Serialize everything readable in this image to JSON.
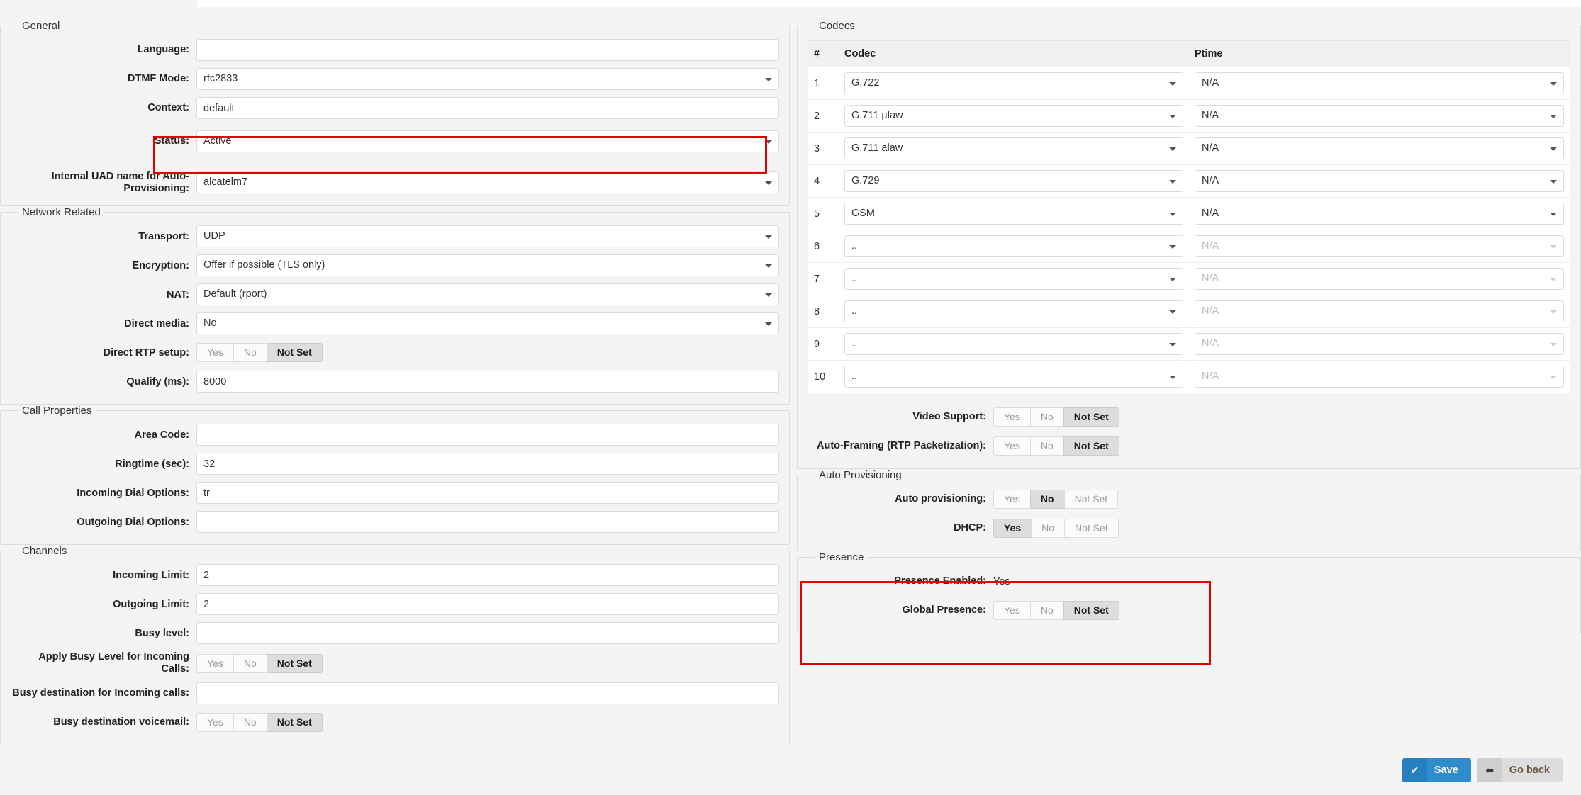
{
  "general": {
    "legend": "General",
    "fields": [
      {
        "label": "Language:",
        "type": "text",
        "value": ""
      },
      {
        "label": "DTMF Mode:",
        "type": "select",
        "value": "rfc2833"
      },
      {
        "label": "Context:",
        "type": "text",
        "value": "default"
      },
      {
        "label": "Status:",
        "type": "select",
        "value": "Active",
        "highlighted": true
      },
      {
        "label": "Internal UAD name for Auto-Provisioning:",
        "type": "select",
        "value": "alcatelm7"
      }
    ]
  },
  "network": {
    "legend": "Network Related",
    "fields": [
      {
        "label": "Transport:",
        "type": "select",
        "value": "UDP"
      },
      {
        "label": "Encryption:",
        "type": "select",
        "value": "Offer if possible (TLS only)"
      },
      {
        "label": "NAT:",
        "type": "select",
        "value": "Default (rport)"
      },
      {
        "label": "Direct media:",
        "type": "select",
        "value": "No"
      },
      {
        "label": "Direct RTP setup:",
        "type": "tristate",
        "value": "Not Set"
      },
      {
        "label": "Qualify (ms):",
        "type": "text",
        "value": "8000"
      }
    ]
  },
  "call_properties": {
    "legend": "Call Properties",
    "fields": [
      {
        "label": "Area Code:",
        "type": "text",
        "value": ""
      },
      {
        "label": "Ringtime (sec):",
        "type": "text",
        "value": "32"
      },
      {
        "label": "Incoming Dial Options:",
        "type": "text",
        "value": "tr"
      },
      {
        "label": "Outgoing Dial Options:",
        "type": "text",
        "value": ""
      }
    ]
  },
  "channels": {
    "legend": "Channels",
    "fields": [
      {
        "label": "Incoming Limit:",
        "type": "text",
        "value": "2"
      },
      {
        "label": "Outgoing Limit:",
        "type": "text",
        "value": "2"
      },
      {
        "label": "Busy level:",
        "type": "text",
        "value": ""
      },
      {
        "label": "Apply Busy Level for Incoming Calls:",
        "type": "tristate",
        "value": "Not Set"
      },
      {
        "label": "Busy destination for Incoming calls:",
        "type": "text",
        "value": ""
      },
      {
        "label": "Busy destination voicemail:",
        "type": "tristate",
        "value": "Not Set"
      }
    ]
  },
  "tristate_options": [
    "Yes",
    "No",
    "Not Set"
  ],
  "codecs": {
    "legend": "Codecs",
    "columns": [
      "#",
      "Codec",
      "Ptime"
    ],
    "rows": [
      {
        "index": "1",
        "codec": "G.722",
        "ptime": "N/A",
        "enabled": true
      },
      {
        "index": "2",
        "codec": "G.711 µlaw",
        "ptime": "N/A",
        "enabled": true
      },
      {
        "index": "3",
        "codec": "G.711 alaw",
        "ptime": "N/A",
        "enabled": true
      },
      {
        "index": "4",
        "codec": "G.729",
        "ptime": "N/A",
        "enabled": true
      },
      {
        "index": "5",
        "codec": "GSM",
        "ptime": "N/A",
        "enabled": true
      },
      {
        "index": "6",
        "codec": "..",
        "ptime": "N/A",
        "enabled": false
      },
      {
        "index": "7",
        "codec": "..",
        "ptime": "N/A",
        "enabled": false
      },
      {
        "index": "8",
        "codec": "..",
        "ptime": "N/A",
        "enabled": false
      },
      {
        "index": "9",
        "codec": "..",
        "ptime": "N/A",
        "enabled": false
      },
      {
        "index": "10",
        "codec": "..",
        "ptime": "N/A",
        "enabled": false
      }
    ],
    "extras": [
      {
        "label": "Video Support:",
        "value": "Not Set"
      },
      {
        "label": "Auto-Framing (RTP Packetization):",
        "value": "Not Set"
      }
    ]
  },
  "auto_provisioning": {
    "legend": "Auto Provisioning",
    "highlighted": true,
    "fields": [
      {
        "label": "Auto provisioning:",
        "value": "No"
      },
      {
        "label": "DHCP:",
        "value": "Yes"
      }
    ]
  },
  "presence": {
    "legend": "Presence",
    "enabled_label": "Presence Enabled:",
    "enabled_value": "Yes",
    "global_label": "Global Presence:",
    "global_value": "Not Set"
  },
  "footer": {
    "save_label": "Save",
    "save_icon": "check-icon",
    "back_label": "Go back",
    "back_icon": "arrow-left-icon"
  },
  "colors": {
    "accent_blue": "#2e8ccd",
    "highlight_red": "#e50000",
    "page_bg": "#f4f4f4"
  }
}
